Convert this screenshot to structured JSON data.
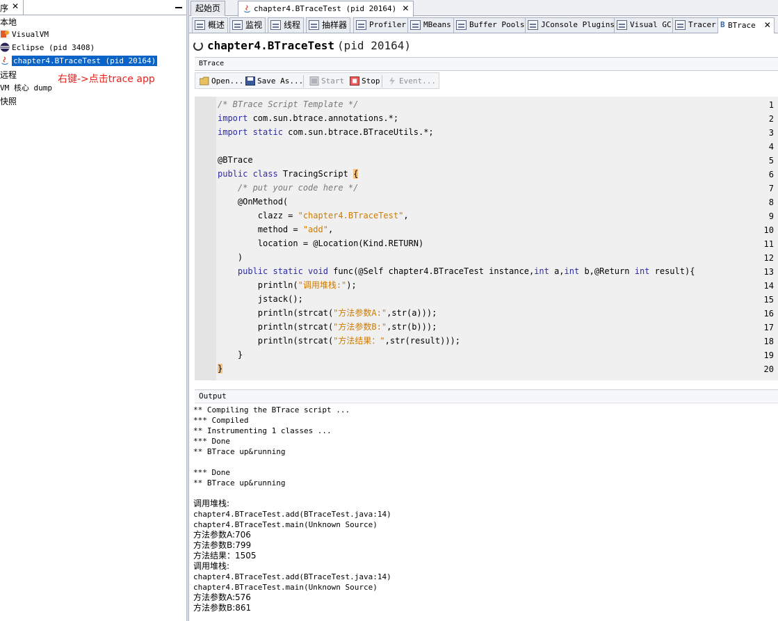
{
  "left_panel": {
    "tab_title": "序",
    "close_glyph": "✕",
    "tree": {
      "local": "本地",
      "visualvm": "VisualVM",
      "eclipse": "Eclipse (pid 3408)",
      "selected_app": "chapter4.BTraceTest (pid 20164)",
      "remote": "远程",
      "vm_core_dump": "VM 核心 dump",
      "snapshots": "快照"
    },
    "annotation": "右键->点击trace app"
  },
  "doc_tabs": [
    {
      "label": "起始页"
    },
    {
      "label": "chapter4.BTraceTest (pid 20164)",
      "close": "✕"
    }
  ],
  "sub_tabs": [
    {
      "label": "概述"
    },
    {
      "label": "监视"
    },
    {
      "label": "线程"
    },
    {
      "label": "抽样器"
    },
    {
      "label": "Profiler"
    },
    {
      "label": "MBeans"
    },
    {
      "label": "Buffer Pools"
    },
    {
      "label": "JConsole Plugins"
    },
    {
      "label": "Visual GC"
    },
    {
      "label": "Tracer"
    },
    {
      "label": "BTrace",
      "close": "✕"
    }
  ],
  "page_title": {
    "main": "chapter4.BTraceTest",
    "pid": "(pid 20164)"
  },
  "btrace_section_label": "BTrace",
  "toolbar": {
    "open": "Open...",
    "save_as": "Save As...",
    "start": "Start",
    "stop": "Stop",
    "event": "Event..."
  },
  "editor": {
    "line_numbers": [
      "1",
      "2",
      "3",
      "4",
      "5",
      "6",
      "7",
      "8",
      "9",
      "10",
      "11",
      "12",
      "13",
      "14",
      "15",
      "16",
      "17",
      "18",
      "19",
      "20"
    ],
    "lines": [
      {
        "t": "/* BTrace Script Template */"
      },
      {
        "a": "import",
        "b": " com.sun.btrace.annotations.*;"
      },
      {
        "a": "import static",
        "b": " com.sun.btrace.BTraceUtils.*;"
      },
      {
        "t": ""
      },
      {
        "t": "@BTrace"
      },
      {
        "a": "public class",
        "b": " TracingScript ",
        "c": "{"
      },
      {
        "t": "    /* put your code here */"
      },
      {
        "t": "    @OnMethod("
      },
      {
        "a": "        clazz = ",
        "b": "\"chapter4.BTraceTest\"",
        "c": ","
      },
      {
        "a": "        method = ",
        "b": "\"add\"",
        "c": ","
      },
      {
        "t": "        location = @Location(Kind.RETURN)"
      },
      {
        "t": "    )"
      },
      {
        "a": "    ",
        "b": "public static void",
        "c": " func(@Self chapter4.BTraceTest instance,",
        "d": "int",
        "e": " a,",
        "f": "int",
        "g": " b,@Return ",
        "h": "int",
        "i": " result){"
      },
      {
        "a": "        println(",
        "b": "\"调用堆栈:\"",
        "c": ");"
      },
      {
        "t": "        jstack();"
      },
      {
        "a": "        println(strcat(",
        "b": "\"方法参数A:\"",
        "c": ",str(a)));"
      },
      {
        "a": "        println(strcat(",
        "b": "\"方法参数B:\"",
        "c": ",str(b)));"
      },
      {
        "a": "        println(strcat(",
        "b": "\"方法结果：\"",
        "c": ",str(result)));"
      },
      {
        "t": "    }"
      },
      {
        "t": "}"
      }
    ]
  },
  "output_section_label": "Output",
  "output_lines": [
    "** Compiling the BTrace script ...",
    "*** Compiled",
    "** Instrumenting 1 classes ...",
    "*** Done",
    "** BTrace up&running",
    "",
    "*** Done",
    "** BTrace up&running",
    "",
    "调用堆栈:",
    "chapter4.BTraceTest.add(BTraceTest.java:14)",
    "chapter4.BTraceTest.main(Unknown Source)",
    "方法参数A:706",
    "方法参数B:799",
    "方法结果：1505",
    "调用堆栈:",
    "chapter4.BTraceTest.add(BTraceTest.java:14)",
    "chapter4.BTraceTest.main(Unknown Source)",
    "方法参数A:576",
    "方法参数B:861"
  ],
  "colors": {
    "selection": "#0a64c8",
    "keyword": "#2a2aa6",
    "string": "#ce7b00",
    "comment": "#787878",
    "annotation_text": "#e8201a",
    "brace_highlight": "#f5c380"
  }
}
